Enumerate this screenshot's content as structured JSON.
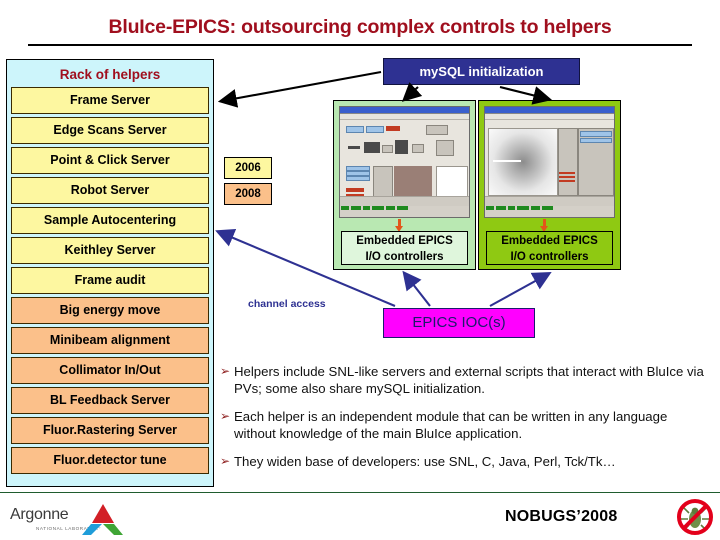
{
  "slide": {
    "title": "BluIce-EPICS: outsourcing complex controls to helpers"
  },
  "rack": {
    "title": "Rack of helpers",
    "items": [
      {
        "label": "Frame Server",
        "era": "2006"
      },
      {
        "label": "Edge Scans Server",
        "era": "2006"
      },
      {
        "label": "Point & Click Server",
        "era": "2006"
      },
      {
        "label": "Robot Server",
        "era": "2006"
      },
      {
        "label": "Sample Autocentering",
        "era": "2006"
      },
      {
        "label": "Keithley Server",
        "era": "2006"
      },
      {
        "label": "Frame audit",
        "era": "2006"
      },
      {
        "label": "Big energy move",
        "era": "2008"
      },
      {
        "label": "Minibeam alignment",
        "era": "2008"
      },
      {
        "label": "Collimator In/Out",
        "era": "2008"
      },
      {
        "label": "BL Feedback Server",
        "era": "2008"
      },
      {
        "label": "Fluor.Rastering Server",
        "era": "2008"
      },
      {
        "label": "Fluor.detector tune",
        "era": "2008"
      }
    ]
  },
  "legend": {
    "year_old": "2006",
    "year_new": "2008",
    "color_old": "#fdf7a0",
    "color_new": "#fbc08a"
  },
  "diagram": {
    "mysql_label": "mySQL initialization",
    "mysql_color": "#2e3192",
    "embedded_left": "Embedded EPICS\nI/O controllers",
    "embedded_left_line1": "Embedded EPICS",
    "embedded_left_line2": "I/O controllers",
    "embedded_right_line1": "Embedded EPICS",
    "embedded_right_line2": "I/O controllers",
    "epics_ioc_label": "EPICS IOC(s)",
    "epics_ioc_color": "#ff00ff",
    "channel_access_label": "channel access",
    "panel_left_color": "#b9e8b2",
    "panel_right_color": "#8fc912",
    "arrow_color": "#2e3192",
    "flow_arrow_color": "#e2551a"
  },
  "bullets": [
    {
      "marker": "➢",
      "text": "Helpers include SNL-like servers and external scripts that interact with BluIce via PVs; some also share mySQL initialization."
    },
    {
      "marker": "➢",
      "text": "Each helper is an independent module that can be written in any language without knowledge of the main BluIce application."
    },
    {
      "marker": "➢",
      "text": "They widen base of developers: use SNL, C, Java, Perl, Tck/Tk…"
    }
  ],
  "footer": {
    "org_name": "Argonne",
    "org_sub": "NATIONAL LABORATORY",
    "conference": "NOBUGS’2008"
  }
}
